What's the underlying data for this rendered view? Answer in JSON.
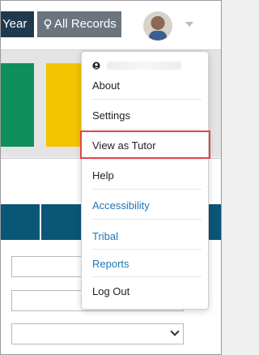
{
  "topbar": {
    "year_label": "Year",
    "records_label": "All Records",
    "records_icon": "lightbulb-icon",
    "avatar_icon": "user-avatar",
    "caret_icon": "chevron-down-icon"
  },
  "menu": {
    "header_icon": "user-circle-icon",
    "items": [
      {
        "label": "About"
      },
      {
        "label": "Settings"
      },
      {
        "label": "View as Tutor",
        "highlighted": true
      },
      {
        "label": "Help"
      },
      {
        "label": "Accessibility"
      },
      {
        "label": "Tribal"
      },
      {
        "label": "Reports"
      },
      {
        "label": "Log Out"
      }
    ]
  },
  "colors": {
    "year_bg": "#1e3a4c",
    "records_bg": "#6c757d",
    "tile_green": "#0e8f5b",
    "tile_yellow": "#f4c300",
    "tab_blue": "#0a5676",
    "link": "#2176b3",
    "highlight_border": "#e0474c"
  }
}
